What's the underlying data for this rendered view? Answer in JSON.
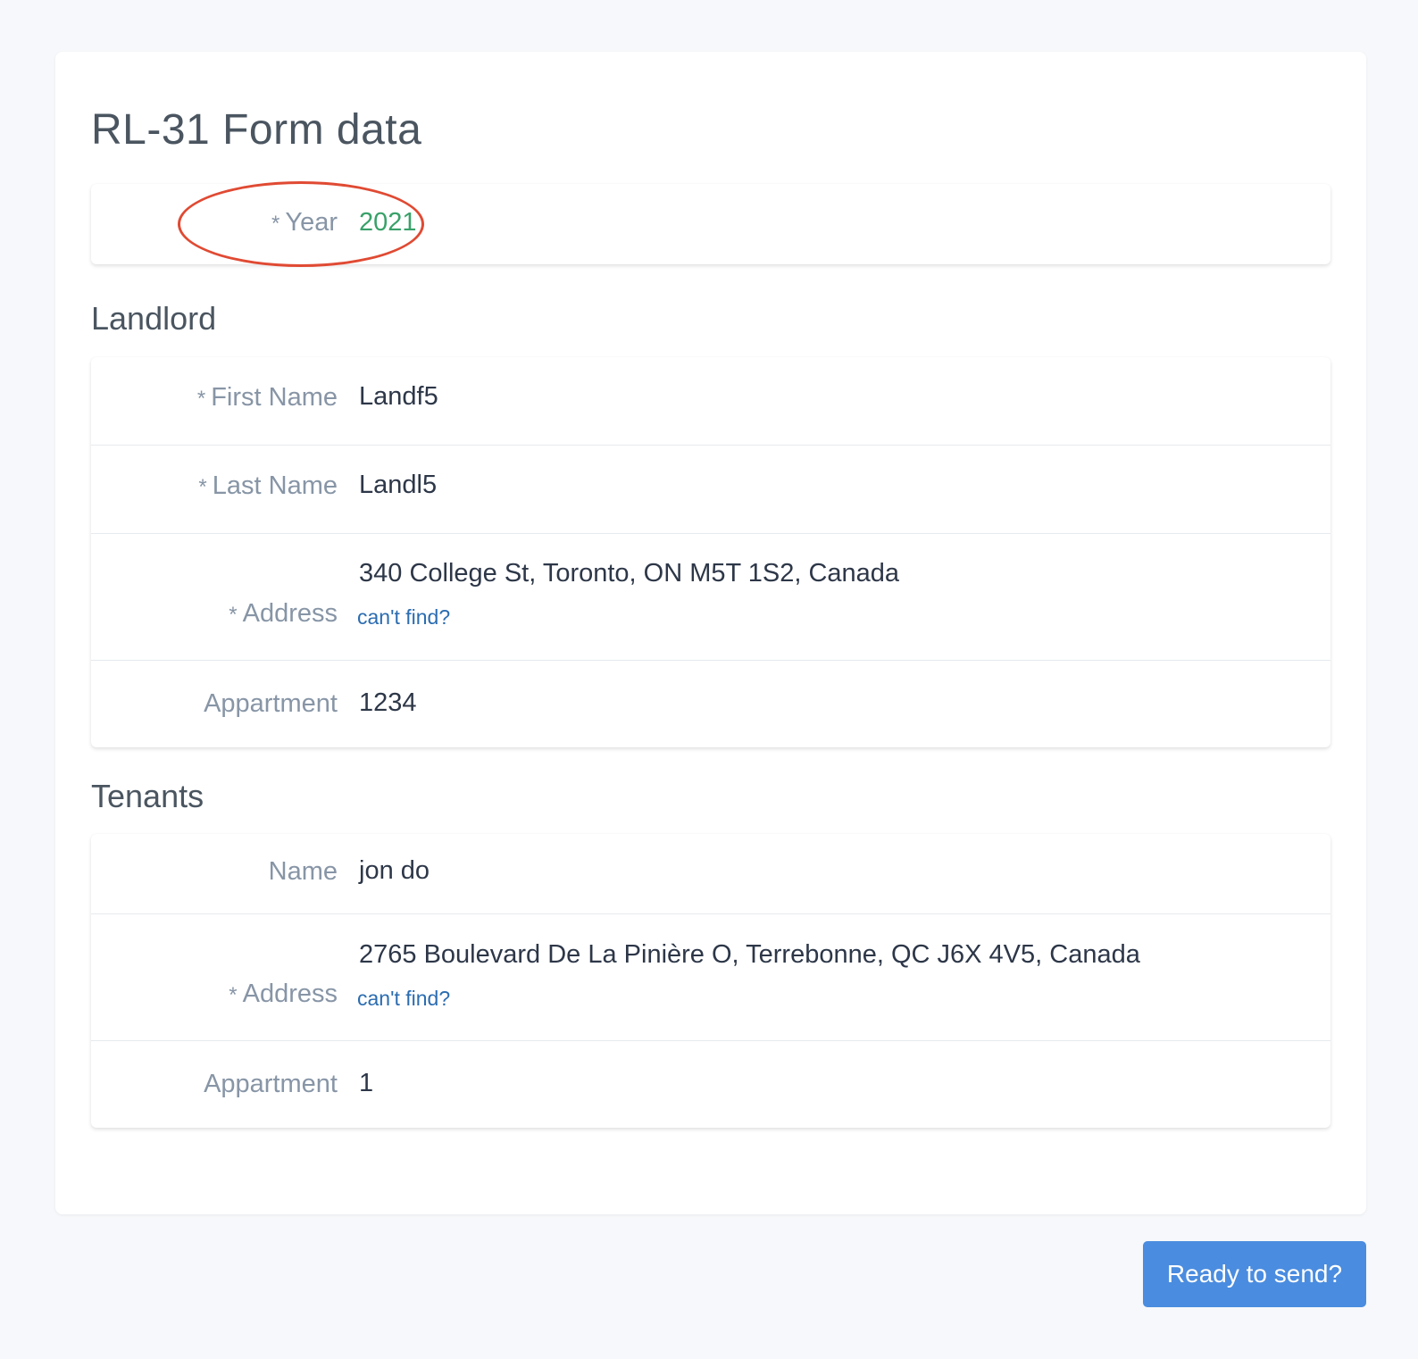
{
  "page": {
    "title": "RL-31 Form data"
  },
  "year_section": {
    "label": "Year",
    "required_marker": "*",
    "value": "2021"
  },
  "landlord": {
    "title": "Landlord",
    "first_name": {
      "required_marker": "*",
      "label": "First Name",
      "value": "Landf5"
    },
    "last_name": {
      "required_marker": "*",
      "label": "Last Name",
      "value": "Landl5"
    },
    "address": {
      "required_marker": "*",
      "label": "Address",
      "value": "340 College St, Toronto, ON M5T 1S2, Canada",
      "link": "can't find?"
    },
    "appartment": {
      "label": "Appartment",
      "value": "1234"
    }
  },
  "tenants": {
    "title": "Tenants",
    "name": {
      "label": "Name",
      "value": "jon do"
    },
    "address": {
      "required_marker": "*",
      "label": "Address",
      "value": "2765 Boulevard De La Pinière O, Terrebonne, QC J6X 4V5, Canada",
      "link": "can't find?"
    },
    "appartment": {
      "label": "Appartment",
      "value": "1"
    }
  },
  "actions": {
    "send_label": "Ready to send?"
  },
  "colors": {
    "accent": "#4a8cdf",
    "value_green": "#38a169",
    "link_blue": "#2b6cb0",
    "annotation_red": "#e04a33",
    "label_gray": "#8795a6"
  }
}
